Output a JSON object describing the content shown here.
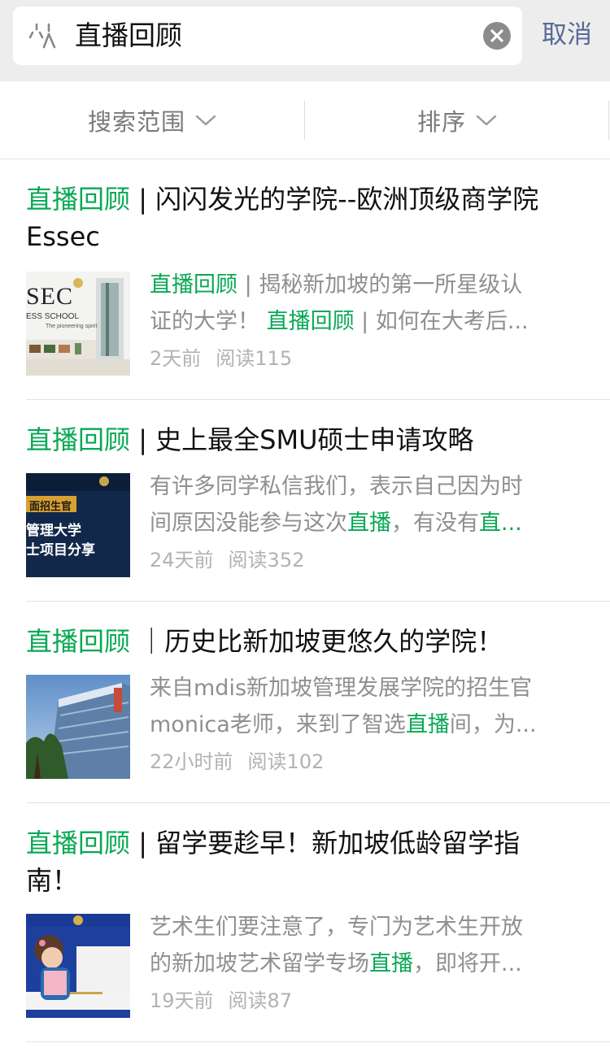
{
  "search": {
    "query": "直播回顾",
    "cancel_label": "取消"
  },
  "filters": {
    "scope_label": "搜索范围",
    "sort_label": "排序"
  },
  "colors": {
    "highlight": "#07a854",
    "cancel": "#576b95",
    "header_bg": "#ededed"
  },
  "results": [
    {
      "title_highlight": "直播回顾",
      "title_rest": " | 闪闪发光的学院--欧洲顶级商学院",
      "title_line2": "Essec",
      "snippet_1_hl": "直播回顾",
      "snippet_1_rest": " | 揭秘新加坡的第一所星级认",
      "snippet_2_text": "证的大学！ ",
      "snippet_2_hl": "直播回顾",
      "snippet_2_rest": " | 如何在大考后...",
      "thumb_text_1": "SEC",
      "thumb_text_2": "ESS SCHOOL",
      "thumb_text_3": "The pioneering spirit",
      "time": "2天前",
      "reads": "阅读115"
    },
    {
      "title_highlight": "直播回顾",
      "title_rest": " | 史上最全SMU硕士申请攻略",
      "snippet_1_text": "有许多同学私信我们，表示自己因为时",
      "snippet_2_text": "间原因没能参与这次",
      "snippet_2_hl": "直播",
      "snippet_2_mid": "，有没有",
      "snippet_2_hl2": "直...",
      "thumb_text_1": "面招生官",
      "thumb_text_2": "管理大学",
      "thumb_text_3": "士项目分享",
      "time": "24天前",
      "reads": "阅读352"
    },
    {
      "title_highlight": "直播回顾",
      "title_rest": " ｜历史比新加坡更悠久的学院！",
      "snippet_1_text": "来自mdis新加坡管理发展学院的招生官",
      "snippet_2_text": "monica老师，来到了智选",
      "snippet_2_hl": "直播",
      "snippet_2_rest": "间，为...",
      "time": "22小时前",
      "reads": "阅读102"
    },
    {
      "title_highlight": "直播回顾",
      "title_rest": " | 留学要趁早！新加坡低龄留学指",
      "title_line2": "南！",
      "snippet_1_text": "艺术生们要注意了，专门为艺术生开放",
      "snippet_2_text": "的新加坡艺术留学专场",
      "snippet_2_hl": "直播",
      "snippet_2_rest": "，即将开...",
      "time": "19天前",
      "reads": "阅读87"
    }
  ]
}
